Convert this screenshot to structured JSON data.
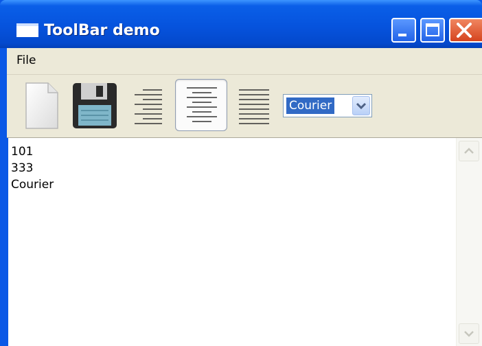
{
  "window": {
    "title": "ToolBar demo"
  },
  "menubar": {
    "items": [
      {
        "label": "File"
      }
    ]
  },
  "toolbar": {
    "tools": [
      {
        "icon": "new-document-icon"
      },
      {
        "icon": "floppy-disk-save-icon"
      },
      {
        "icon": "align-right-icon"
      },
      {
        "icon": "align-center-icon",
        "pressed": true
      },
      {
        "icon": "justify-icon"
      }
    ],
    "font_combo": {
      "selected": "Courier"
    }
  },
  "editor": {
    "lines": [
      "101",
      "333",
      "Courier"
    ]
  },
  "colors": {
    "titlebar": "#0653dd",
    "chrome": "#ece9d8",
    "selection": "#316ac5",
    "close_button": "#d5441f"
  }
}
